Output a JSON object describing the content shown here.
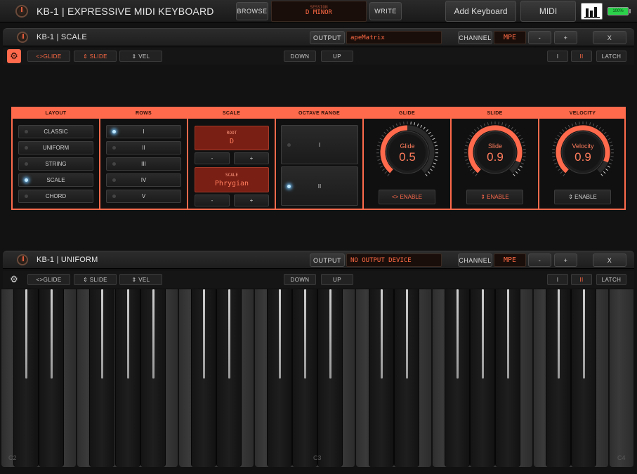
{
  "app": {
    "title": "KB-1 | EXPRESSIVE MIDI KEYBOARD",
    "browse_label": "BROWSE",
    "session_caption": "SESSION",
    "session_value": "D MINOR",
    "write_label": "WRITE",
    "add_keyboard_label": "Add Keyboard",
    "midi_label": "MIDI",
    "battery_label": "100%"
  },
  "panel1": {
    "title": "KB-1 | SCALE",
    "output_label": "OUTPUT",
    "output_value": "apeMatrix",
    "channel_label": "CHANNEL",
    "channel_value": "MPE",
    "minus_label": "-",
    "plus_label": "+",
    "close_label": "X",
    "toolbar": {
      "glide_label": "<>GLIDE",
      "slide_label": "⇕ SLIDE",
      "vel_label": "⇕ VEL",
      "down_label": "DOWN",
      "up_label": "UP",
      "row1_label": "I",
      "row2_label": "II",
      "latch_label": "LATCH"
    }
  },
  "settings": {
    "layout": {
      "header": "LAYOUT",
      "options": [
        "CLASSIC",
        "UNIFORM",
        "STRING",
        "SCALE",
        "CHORD"
      ],
      "selected": "SCALE"
    },
    "rows": {
      "header": "ROWS",
      "options": [
        "I",
        "II",
        "III",
        "IV",
        "V"
      ],
      "selected": "I"
    },
    "scale": {
      "header": "SCALE",
      "root_caption": "ROOT",
      "root_value": "D",
      "scale_caption": "SCALE",
      "scale_value": "Phrygian",
      "minus_label": "-",
      "plus_label": "+"
    },
    "octave_range": {
      "header": "OCTAVE RANGE",
      "options": [
        "I",
        "II"
      ],
      "selected": "II"
    },
    "glide": {
      "header": "GLIDE",
      "knob_label": "Glide",
      "knob_value": "0.5",
      "knob_level": 0.5,
      "enable_label": "<> ENABLE"
    },
    "slide": {
      "header": "SLIDE",
      "knob_label": "Slide",
      "knob_value": "0.9",
      "knob_level": 0.9,
      "enable_label": "⇕ ENABLE"
    },
    "velocity": {
      "header": "VELOCITY",
      "knob_label": "Velocity",
      "knob_value": "0.9",
      "knob_level": 0.9,
      "enable_label": "⇕ ENABLE"
    }
  },
  "panel2": {
    "title": "KB-1 | UNIFORM",
    "output_label": "OUTPUT",
    "output_value": "NO OUTPUT DEVICE",
    "channel_label": "CHANNEL",
    "channel_value": "MPE",
    "minus_label": "-",
    "plus_label": "+",
    "close_label": "X",
    "toolbar": {
      "glide_label": "<>GLIDE",
      "slide_label": "⇕ SLIDE",
      "vel_label": "⇕ VEL",
      "down_label": "DOWN",
      "up_label": "UP",
      "row1_label": "I",
      "row2_label": "II",
      "latch_label": "LATCH"
    }
  },
  "keyboard": {
    "octave_labels": [
      "C2",
      "C3",
      "C4"
    ]
  },
  "colors": {
    "accent": "#ff6a4c",
    "lcd_text": "#ff6a44",
    "led_on": "#bfe8ff",
    "battery": "#2ad24a"
  }
}
